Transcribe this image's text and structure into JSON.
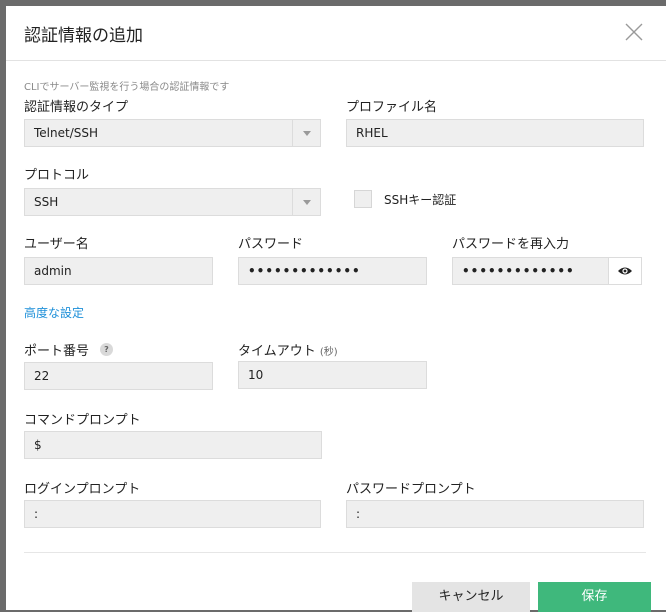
{
  "dialog": {
    "title": "認証情報の追加",
    "description": "CLIでサーバー監視を行う場合の認証情報です"
  },
  "fields": {
    "credential_type": {
      "label": "認証情報のタイプ",
      "value": "Telnet/SSH"
    },
    "profile_name": {
      "label": "プロファイル名",
      "value": "RHEL"
    },
    "protocol": {
      "label": "プロトコル",
      "value": "SSH"
    },
    "ssh_key_auth": {
      "label": "SSHキー認証",
      "checked": false
    },
    "username": {
      "label": "ユーザー名",
      "value": "admin"
    },
    "password": {
      "label": "パスワード",
      "value": "•••••••••••••"
    },
    "password_confirm": {
      "label": "パスワードを再入力",
      "value": "•••••••••••••"
    },
    "advanced_link": "高度な設定",
    "port": {
      "label": "ポート番号",
      "help": "?",
      "value": "22"
    },
    "timeout": {
      "label": "タイムアウト",
      "unit": "(秒)",
      "value": "10"
    },
    "command_prompt": {
      "label": "コマンドプロンプト",
      "value": "$"
    },
    "login_prompt": {
      "label": "ログインプロンプト",
      "value": ":"
    },
    "password_prompt": {
      "label": "パスワードプロンプト",
      "value": ":"
    }
  },
  "buttons": {
    "cancel": "キャンセル",
    "save": "保存"
  },
  "icons": {
    "close": "close-icon",
    "dropdown": "caret-down-icon",
    "show_password": "eye-icon",
    "help": "help-icon"
  },
  "colors": {
    "save_button": "#3fb87c",
    "link": "#1d8fd8",
    "field_background": "#efefef"
  }
}
